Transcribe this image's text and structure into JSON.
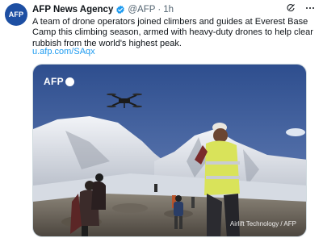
{
  "post": {
    "avatar_text": "AFP",
    "author_name": "AFP News Agency",
    "handle": "@AFP",
    "separator": "·",
    "timestamp": "1h",
    "text": "A team of drone operators joined climbers and guides at Everest Base Camp this climbing season, armed with heavy-duty drones to help clear rubbish from the world's highest peak.",
    "link": "u.afp.com/SAqx"
  },
  "media": {
    "logo_text": "AFP",
    "credit": "Airlift Technology / AFP"
  },
  "icons": {
    "verified": "verified-badge-icon",
    "grok": "grok-icon",
    "more": "more-icon"
  },
  "colors": {
    "link": "#1d9bf0",
    "verified": "#1d9bf0",
    "avatar_bg": "#1d4fa3",
    "secondary_text": "#536471"
  }
}
